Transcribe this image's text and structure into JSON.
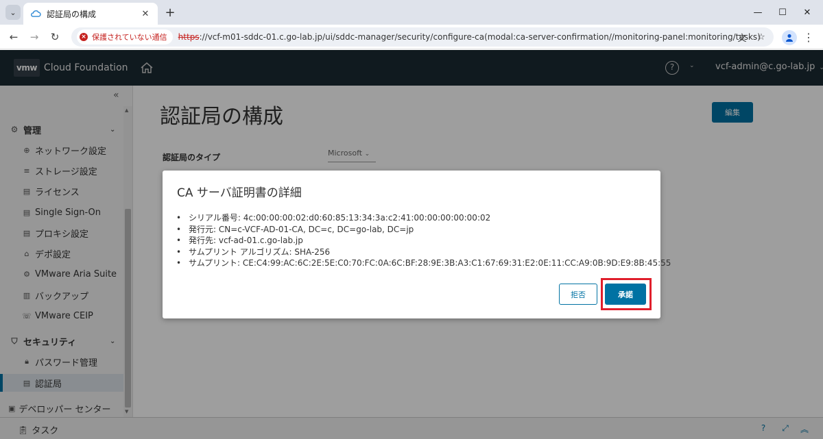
{
  "browser": {
    "tab_title": "認証局の構成",
    "security_label": "保護されていない通信",
    "url_scheme": "https",
    "url_rest": "://vcf-m01-sddc-01.c.go-lab.jp/ui/sddc-manager/security/configure-ca(modal:ca-server-confirmation//monitoring-panel:monitoring/tasks)"
  },
  "header": {
    "logo_mark": "vmw",
    "product": "Cloud Foundation",
    "help_glyph": "?",
    "user": "vcf-admin@c.go-lab.jp"
  },
  "sidebar": {
    "sections": [
      {
        "label": "管理",
        "items": [
          {
            "label": "ネットワーク設定"
          },
          {
            "label": "ストレージ設定"
          },
          {
            "label": "ライセンス"
          },
          {
            "label": "Single Sign-On"
          },
          {
            "label": "プロキシ設定"
          },
          {
            "label": "デポ設定"
          },
          {
            "label": "VMware Aria Suite"
          },
          {
            "label": "バックアップ"
          },
          {
            "label": "VMware CEIP"
          }
        ]
      },
      {
        "label": "セキュリティ",
        "items": [
          {
            "label": "パスワード管理"
          },
          {
            "label": "認証局"
          }
        ]
      }
    ],
    "bottom_item": "デベロッパー センター"
  },
  "main": {
    "title": "認証局の構成",
    "edit_button": "編集",
    "ca_type_label": "認証局のタイプ",
    "ca_type_value": "Microsoft"
  },
  "taskbar": {
    "label": "タスク"
  },
  "modal": {
    "title": "CA サーバ証明書の詳細",
    "details": [
      "シリアル番号: 4c:00:00:00:02:d0:60:85:13:34:3a:c2:41:00:00:00:00:00:02",
      "発行元: CN=c-VCF-AD-01-CA, DC=c, DC=go-lab, DC=jp",
      "発行先: vcf-ad-01.c.go-lab.jp",
      "サムプリント アルゴリズム: SHA-256",
      "サムプリント: CE:C4:99:AC:6C:2E:5E:C0:70:FC:0A:6C:BF:28:9E:3B:A3:C1:67:69:31:E2:0E:11:CC:A9:0B:9D:E9:8B:45:55"
    ],
    "reject_button": "拒否",
    "accept_button": "承諾"
  },
  "colors": {
    "primary": "#0072a3",
    "header_bg": "#1b2a32",
    "highlight": "#e01e2b",
    "insecure": "#c5221f"
  }
}
